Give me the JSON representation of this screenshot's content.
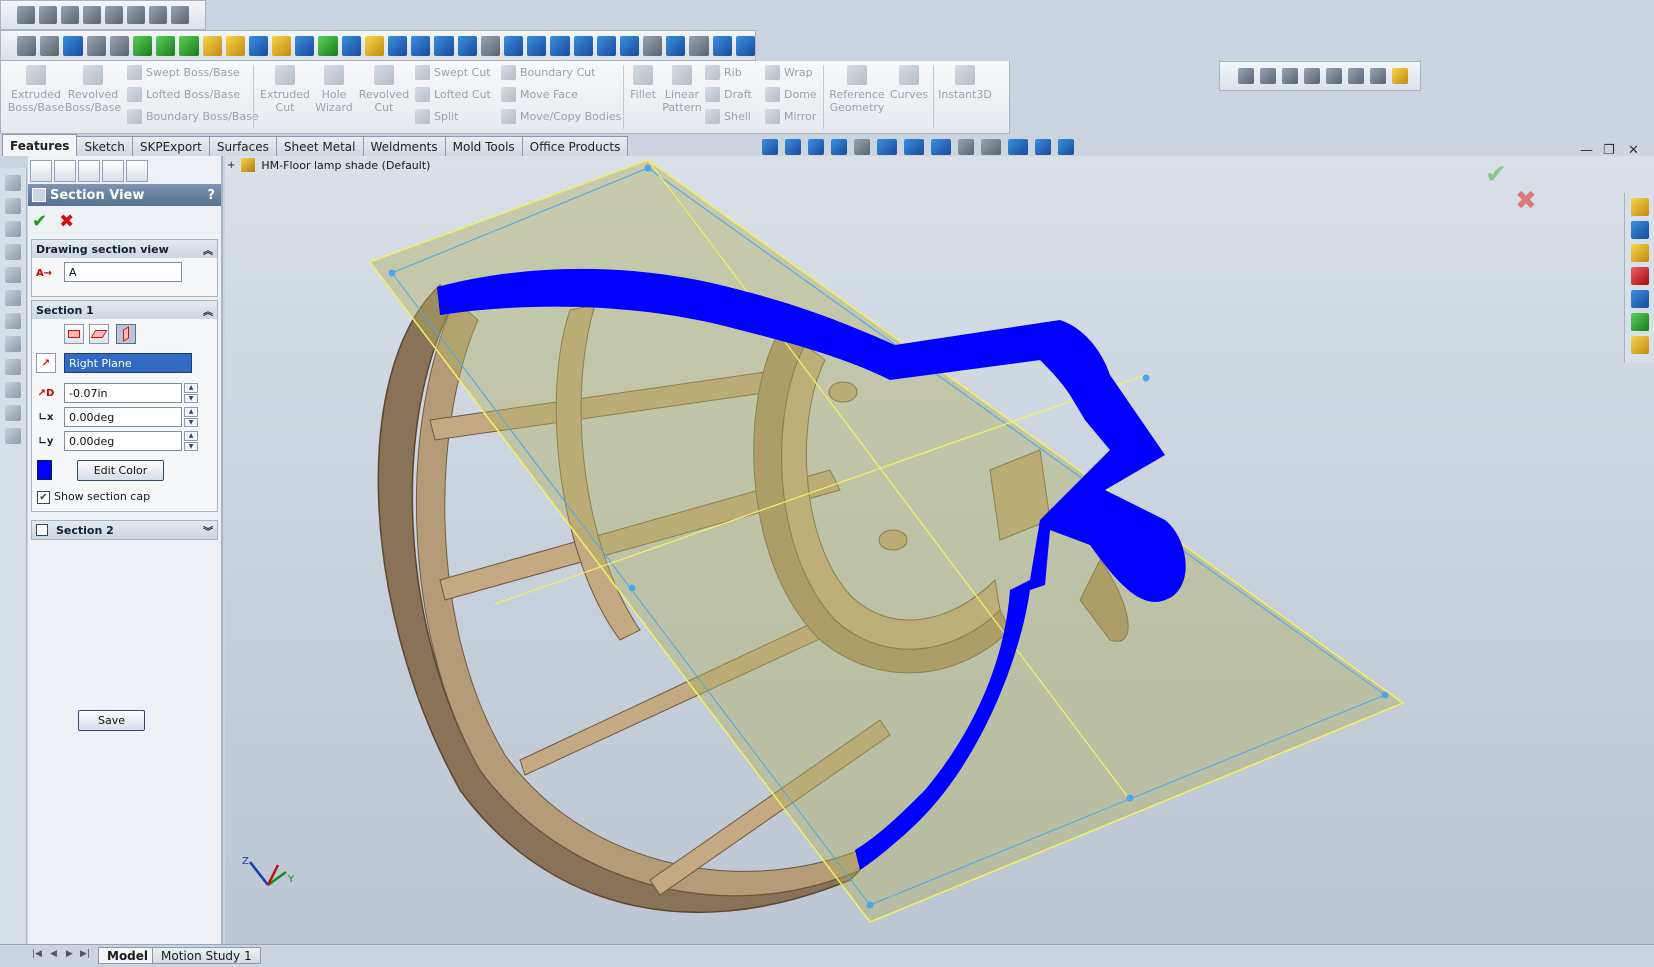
{
  "command_manager": {
    "extruded_boss": "Extruded\nBoss/Base",
    "revolved_boss": "Revolved\nBoss/Base",
    "swept_boss": "Swept Boss/Base",
    "lofted_boss": "Lofted Boss/Base",
    "boundary_boss": "Boundary Boss/Base",
    "extruded_cut": "Extruded\nCut",
    "hole_wizard": "Hole\nWizard",
    "revolved_cut": "Revolved\nCut",
    "swept_cut": "Swept Cut",
    "lofted_cut": "Lofted Cut",
    "split": "Split",
    "boundary_cut": "Boundary Cut",
    "move_face": "Move Face",
    "move_copy": "Move/Copy Bodies",
    "fillet": "Fillet",
    "linear_pattern": "Linear\nPattern",
    "rib": "Rib",
    "draft": "Draft",
    "shell": "Shell",
    "wrap": "Wrap",
    "dome": "Dome",
    "mirror": "Mirror",
    "reference_geometry": "Reference\nGeometry",
    "curves": "Curves",
    "instant3d": "Instant3D"
  },
  "tabs": [
    "Features",
    "Sketch",
    "SKPExport",
    "Surfaces",
    "Sheet Metal",
    "Weldments",
    "Mold Tools",
    "Office Products"
  ],
  "property_manager": {
    "title": "Section View",
    "help": "?",
    "drawing_section_view": {
      "header": "Drawing section view",
      "value": "A"
    },
    "section1": {
      "header": "Section 1",
      "plane": "Right Plane",
      "offset": "-0.07in",
      "rot_x": "0.00deg",
      "rot_y": "0.00deg",
      "edit_color": "Edit Color",
      "show_section_cap": "Show section cap",
      "cap_color": "#0000ff"
    },
    "section2": {
      "header": "Section 2"
    },
    "save": "Save"
  },
  "feature_tree": {
    "part_name": "HM-Floor lamp shade  (Default)"
  },
  "bottom_tabs": [
    "Model",
    "Motion Study 1"
  ]
}
